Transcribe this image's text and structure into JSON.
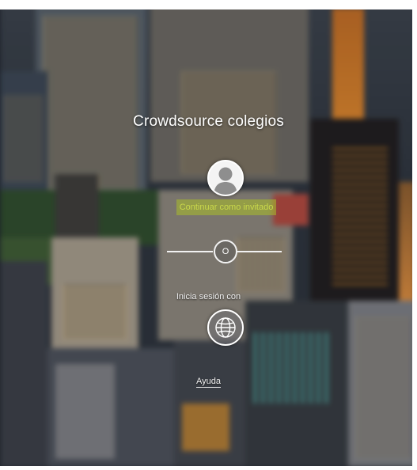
{
  "app": {
    "title": "Crowdsource colegios"
  },
  "login": {
    "guest_label": "Continuar como invitado",
    "or_label": "O",
    "signin_with_label": "Inicia sesión con",
    "help_label": "Ayuda"
  },
  "icons": {
    "guest": "user-silhouette-icon",
    "provider": "globe-icon"
  },
  "colors": {
    "guest_highlight": "#aabe28",
    "guest_text": "#c9d84a",
    "text": "#ffffff"
  }
}
